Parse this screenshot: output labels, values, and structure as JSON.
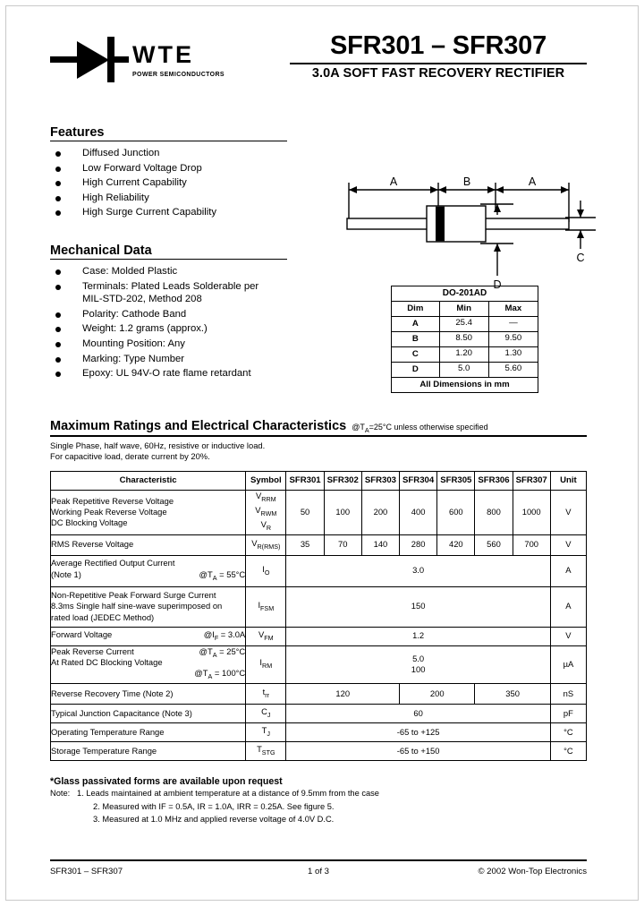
{
  "header": {
    "logo_word": "WTE",
    "logo_tagline": "POWER SEMICONDUCTORS",
    "title": "SFR301 – SFR307",
    "subtitle": "3.0A SOFT FAST RECOVERY RECTIFIER"
  },
  "features": {
    "heading": "Features",
    "items": [
      "Diffused Junction",
      "Low Forward Voltage Drop",
      "High Current Capability",
      "High Reliability",
      "High Surge Current Capability"
    ]
  },
  "mechanical": {
    "heading": "Mechanical Data",
    "items": [
      "Case: Molded Plastic",
      "Terminals: Plated Leads Solderable per",
      "Polarity: Cathode Band",
      "Weight: 1.2 grams (approx.)",
      "Mounting Position: Any",
      "Marking: Type Number",
      "Epoxy: UL 94V-O rate flame retardant"
    ],
    "terminals_line2": "MIL-STD-202, Method 208"
  },
  "package": {
    "label_a_left": "A",
    "label_b": "B",
    "label_a_right": "A",
    "label_c": "C",
    "label_d": "D"
  },
  "dim_table": {
    "title": "DO-201AD",
    "headers": [
      "Dim",
      "Min",
      "Max"
    ],
    "rows": [
      {
        "dim": "A",
        "min": "25.4",
        "max": "—"
      },
      {
        "dim": "B",
        "min": "8.50",
        "max": "9.50"
      },
      {
        "dim": "C",
        "min": "1.20",
        "max": "1.30"
      },
      {
        "dim": "D",
        "min": "5.0",
        "max": "5.60"
      }
    ],
    "footer": "All Dimensions in mm"
  },
  "ratings": {
    "heading": "Maximum Ratings and Electrical Characteristics",
    "condition": "@TA=25°C unless otherwise specified",
    "line1": "Single Phase, half wave, 60Hz, resistive or inductive load.",
    "line2": "For capacitive load, derate current by 20%.",
    "columns": {
      "characteristic": "Characteristic",
      "symbol": "Symbol",
      "parts": [
        "SFR301",
        "SFR302",
        "SFR303",
        "SFR304",
        "SFR305",
        "SFR306",
        "SFR307"
      ],
      "unit": "Unit"
    },
    "rows": [
      {
        "char_lines": [
          "Peak Repetitive Reverse Voltage",
          "Working Peak Reverse Voltage",
          "DC Blocking Voltage"
        ],
        "symbol_lines": [
          "VRRM",
          "VRWM",
          "VR"
        ],
        "values": [
          "50",
          "100",
          "200",
          "400",
          "600",
          "800",
          "1000"
        ],
        "unit": "V"
      },
      {
        "char_lines": [
          "RMS Reverse Voltage"
        ],
        "symbol_lines": [
          "VR(RMS)"
        ],
        "values": [
          "35",
          "70",
          "140",
          "280",
          "420",
          "560",
          "700"
        ],
        "unit": "V"
      },
      {
        "char_lines": [
          "Average Rectified Output Current",
          "(Note 1)"
        ],
        "char_at": "@TA = 55°C",
        "symbol_lines": [
          "IO"
        ],
        "merged_value": "3.0",
        "unit": "A"
      },
      {
        "char_lines": [
          "Non-Repetitive Peak Forward Surge Current",
          "8.3ms Single half sine-wave superimposed on",
          "rated load (JEDEC Method)"
        ],
        "symbol_lines": [
          "IFSM"
        ],
        "merged_value": "150",
        "unit": "A"
      },
      {
        "char_lines": [
          "Forward Voltage"
        ],
        "char_at": "@IF = 3.0A",
        "symbol_lines": [
          "VFM"
        ],
        "merged_value": "1.2",
        "unit": "V"
      },
      {
        "char_lines": [
          "Peak Reverse Current",
          "At Rated DC Blocking Voltage"
        ],
        "char_at_lines": [
          "@TA = 25°C",
          "@TA = 100°C"
        ],
        "symbol_lines": [
          "IRM"
        ],
        "merged_value_lines": [
          "5.0",
          "100"
        ],
        "unit": "µA"
      },
      {
        "char_lines": [
          "Reverse Recovery Time (Note 2)"
        ],
        "symbol_lines": [
          "trr"
        ],
        "split_values": [
          "120",
          "200",
          "350"
        ],
        "unit": "nS"
      },
      {
        "char_lines": [
          "Typical Junction Capacitance (Note 3)"
        ],
        "symbol_lines": [
          "Cj"
        ],
        "merged_value": "60",
        "unit": "pF"
      },
      {
        "char_lines": [
          "Operating Temperature Range"
        ],
        "symbol_lines": [
          "TJ"
        ],
        "merged_value": "-65 to +125",
        "unit": "°C"
      },
      {
        "char_lines": [
          "Storage Temperature Range"
        ],
        "symbol_lines": [
          "TSTG"
        ],
        "merged_value": "-65 to +150",
        "unit": "°C"
      }
    ]
  },
  "notes": {
    "glass": "*Glass passivated forms are available upon request",
    "label": "Note:",
    "items": [
      "1. Leads maintained at ambient temperature at a distance of 9.5mm from the case",
      "2. Measured with IF = 0.5A, IR = 1.0A, IRR = 0.25A. See figure 5.",
      "3. Measured at 1.0 MHz and applied reverse voltage of 4.0V D.C."
    ]
  },
  "footer": {
    "left": "SFR301 – SFR307",
    "center": "1 of 3",
    "right": "© 2002 Won-Top Electronics"
  }
}
